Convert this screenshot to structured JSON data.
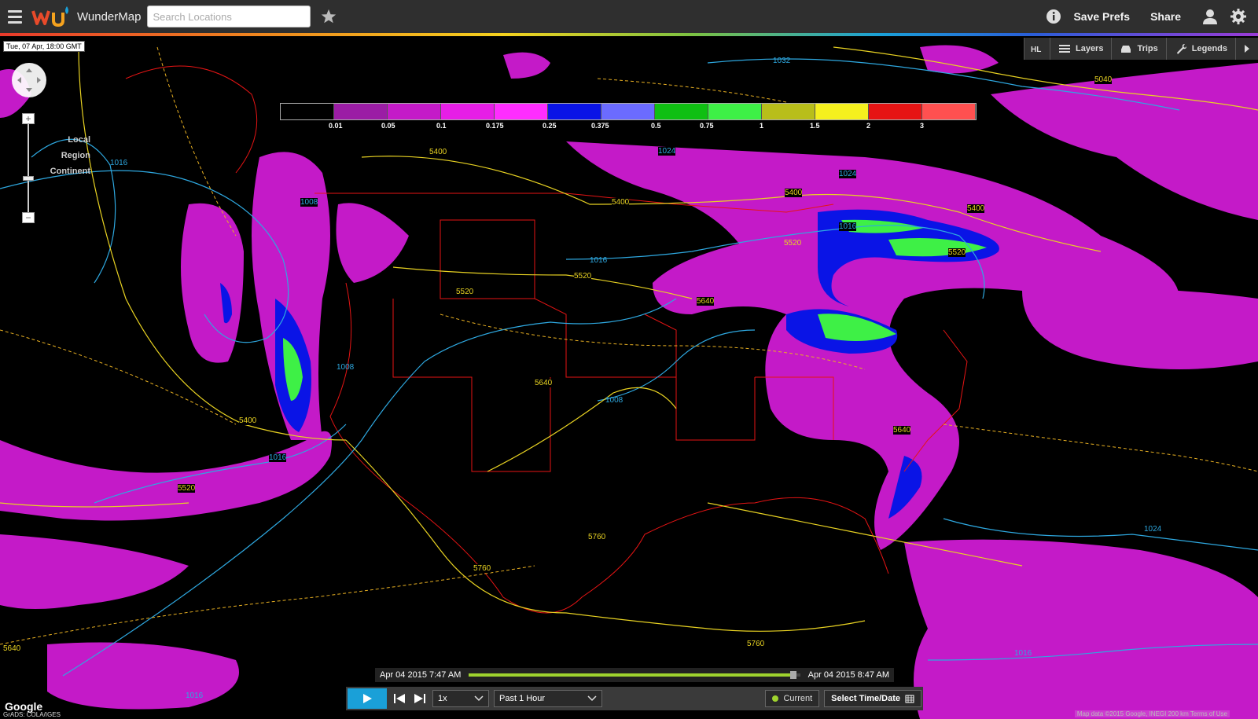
{
  "app": {
    "brand_name": "WunderMap",
    "search_placeholder": "Search Locations",
    "top_actions": {
      "save_prefs": "Save Prefs",
      "share": "Share"
    }
  },
  "icons": [
    "menu-icon",
    "wu-logo",
    "star-icon",
    "info-icon",
    "user-icon",
    "gear-icon",
    "layers-icon",
    "car-icon",
    "wrench-icon",
    "play-icon",
    "skip-back-icon",
    "skip-forward-icon",
    "calendar-icon",
    "chevron-down-icon",
    "pan-control-icon"
  ],
  "map": {
    "timestamp": "Tue, 07 Apr, 18:00 GMT",
    "zoom_levels": [
      "Local",
      "Region",
      "Continent"
    ],
    "toolbar": {
      "layers": "Layers",
      "trips": "Trips",
      "legends": "Legends"
    },
    "legend": {
      "colors": [
        "#000000",
        "#9b1da5",
        "#c41ac8",
        "#e61ee6",
        "#ff2dff",
        "#0a14e6",
        "#6b6bff",
        "#0fbf12",
        "#3ef046",
        "#b8be1a",
        "#f5f01e",
        "#e61414",
        "#ff5050"
      ],
      "labels": [
        "0.01",
        "0.05",
        "0.1",
        "0.175",
        "0.25",
        "0.375",
        "0.5",
        "0.75",
        "1",
        "1.5",
        "2",
        "3"
      ]
    },
    "isobar_labels": [
      "1032",
      "1016",
      "1008",
      "1008",
      "1016",
      "1024",
      "1024",
      "1016",
      "1016",
      "1024",
      "1016",
      "1008",
      "1016"
    ],
    "height_labels": [
      "5400",
      "5400",
      "5400",
      "5400",
      "5400",
      "5520",
      "5520",
      "5520",
      "5520",
      "5640",
      "5640",
      "5640",
      "5640",
      "5760",
      "5760",
      "5760",
      "5040",
      "5520"
    ],
    "attribution": "Map data ©2015 Google, INEGI  200 km  Terms of Use",
    "google_logo": "Google",
    "grads": "GrADS: COLA/IGES"
  },
  "timeline": {
    "start": "Apr 04 2015 7:47 AM",
    "end": "Apr 04 2015 8:47 AM",
    "progress": 0.98
  },
  "controls": {
    "speed": "1x",
    "range": "Past 1 Hour",
    "current": "Current",
    "select_time": "Select Time/Date"
  }
}
